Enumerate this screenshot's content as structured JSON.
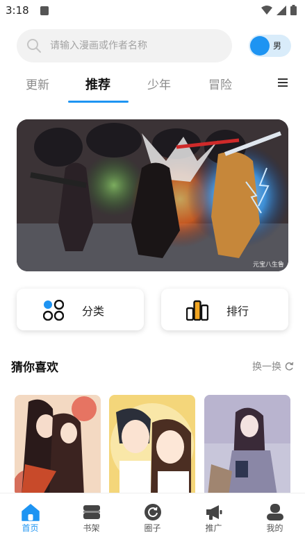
{
  "status_bar": {
    "time": "3:18"
  },
  "search": {
    "placeholder": "请输入漫画或作者名称"
  },
  "gender_toggle": {
    "label": "男",
    "accent": "#1e94f2"
  },
  "tabs": [
    {
      "label": "更新",
      "active": false
    },
    {
      "label": "推荐",
      "active": true
    },
    {
      "label": "少年",
      "active": false
    },
    {
      "label": "冒险",
      "active": false
    }
  ],
  "banner": {
    "credit": "元宝八生鲁"
  },
  "quick_actions": [
    {
      "label": "分类",
      "icon": "category-grid-icon"
    },
    {
      "label": "排行",
      "icon": "ranking-bars-icon"
    }
  ],
  "recommend": {
    "title": "猜你喜欢",
    "refresh_label": "换一换"
  },
  "bottom_nav": [
    {
      "label": "首页",
      "icon": "home-icon",
      "active": true
    },
    {
      "label": "书架",
      "icon": "bookshelf-icon",
      "active": false
    },
    {
      "label": "圈子",
      "icon": "circle-icon",
      "active": false
    },
    {
      "label": "推广",
      "icon": "megaphone-icon",
      "active": false
    },
    {
      "label": "我的",
      "icon": "profile-icon",
      "active": false
    }
  ]
}
